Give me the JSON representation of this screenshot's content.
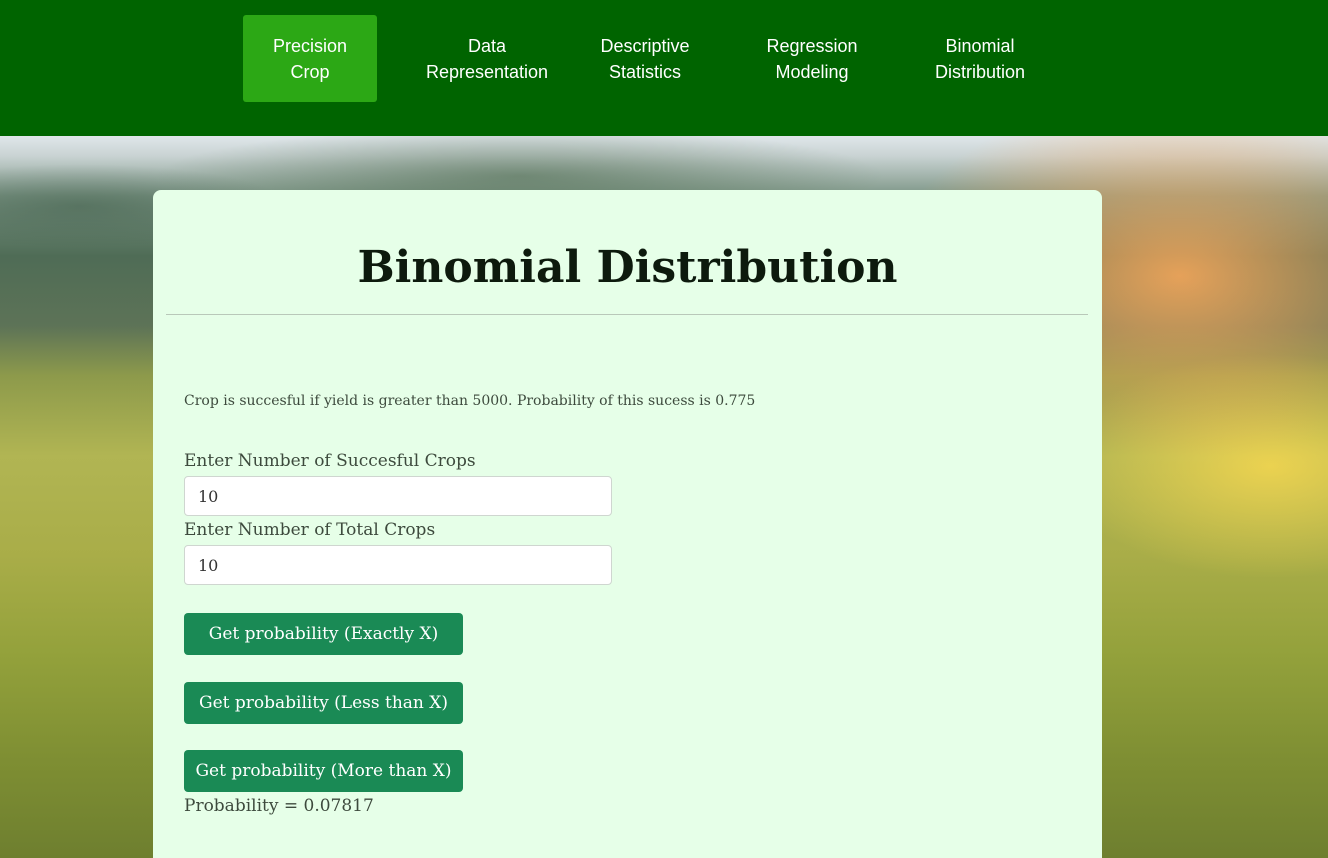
{
  "nav": {
    "items": [
      {
        "label": "Precision\nCrop",
        "active": true
      },
      {
        "label": "Data\nRepresentation",
        "active": false
      },
      {
        "label": "Descriptive\nStatistics",
        "active": false
      },
      {
        "label": "Regression\nModeling",
        "active": false
      },
      {
        "label": "Binomial\nDistribution",
        "active": false
      }
    ]
  },
  "colors": {
    "nav_bg": "#006400",
    "nav_active": "#2ca815",
    "card_bg": "#e6ffe8",
    "button_bg": "#1a8a55"
  },
  "page": {
    "title": "Binomial Distribution",
    "description": "Crop is succesful if yield is greater than 5000. Probability of this sucess is 0.775"
  },
  "form": {
    "successful_label": "Enter Number of Succesful Crops",
    "successful_value": "10",
    "total_label": "Enter Number of Total Crops",
    "total_value": "10",
    "btn_exact": "Get probability (Exactly X)",
    "btn_less": "Get probability (Less than X)",
    "btn_more": "Get probability (More than X)"
  },
  "result": {
    "text": "Probability = 0.07817"
  }
}
